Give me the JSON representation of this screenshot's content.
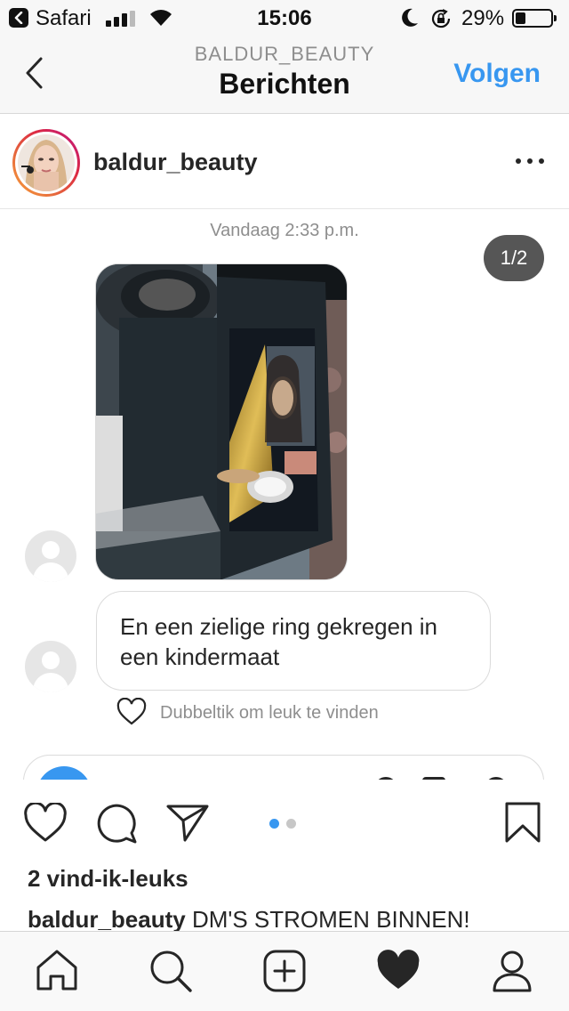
{
  "status_bar": {
    "back_app": "Safari",
    "time": "15:06",
    "battery": "29%",
    "icons": [
      "back-arrow-icon",
      "signal-icon",
      "wifi-icon",
      "moon-icon",
      "rotation-lock-icon",
      "battery-icon"
    ]
  },
  "nav": {
    "subtitle": "BALDUR_BEAUTY",
    "title": "Berichten",
    "follow": "Volgen",
    "back_icon": "chevron-left-icon"
  },
  "post_header": {
    "username": "baldur_beauty",
    "more_icon": "more-horizontal-icon"
  },
  "chat": {
    "timestamp": "Vandaag 2:33 p.m.",
    "carousel": "1/2",
    "message_text": "En een zielige ring gekregen in een kindermaat",
    "like_hint": "Dubbeltik om leuk te vinden"
  },
  "actions": {
    "icons": [
      "heart-outline-icon",
      "comment-icon",
      "share-icon",
      "bookmark-icon"
    ],
    "carousel_dots": {
      "count": 2,
      "active_index": 0,
      "active_color": "#3897f0",
      "inactive_color": "#c7c7c7"
    }
  },
  "likes": "2 vind-ik-leuks",
  "caption": {
    "username": "baldur_beauty",
    "text": "DM'S STROMEN BINNEN!"
  },
  "tab_bar": {
    "icons": [
      "home-icon",
      "search-icon",
      "new-post-icon",
      "activity-heart-icon",
      "profile-icon"
    ]
  },
  "colors": {
    "accent": "#3897f0",
    "text": "#262626",
    "muted": "#8e8e8e",
    "border": "#dbdbdb"
  }
}
